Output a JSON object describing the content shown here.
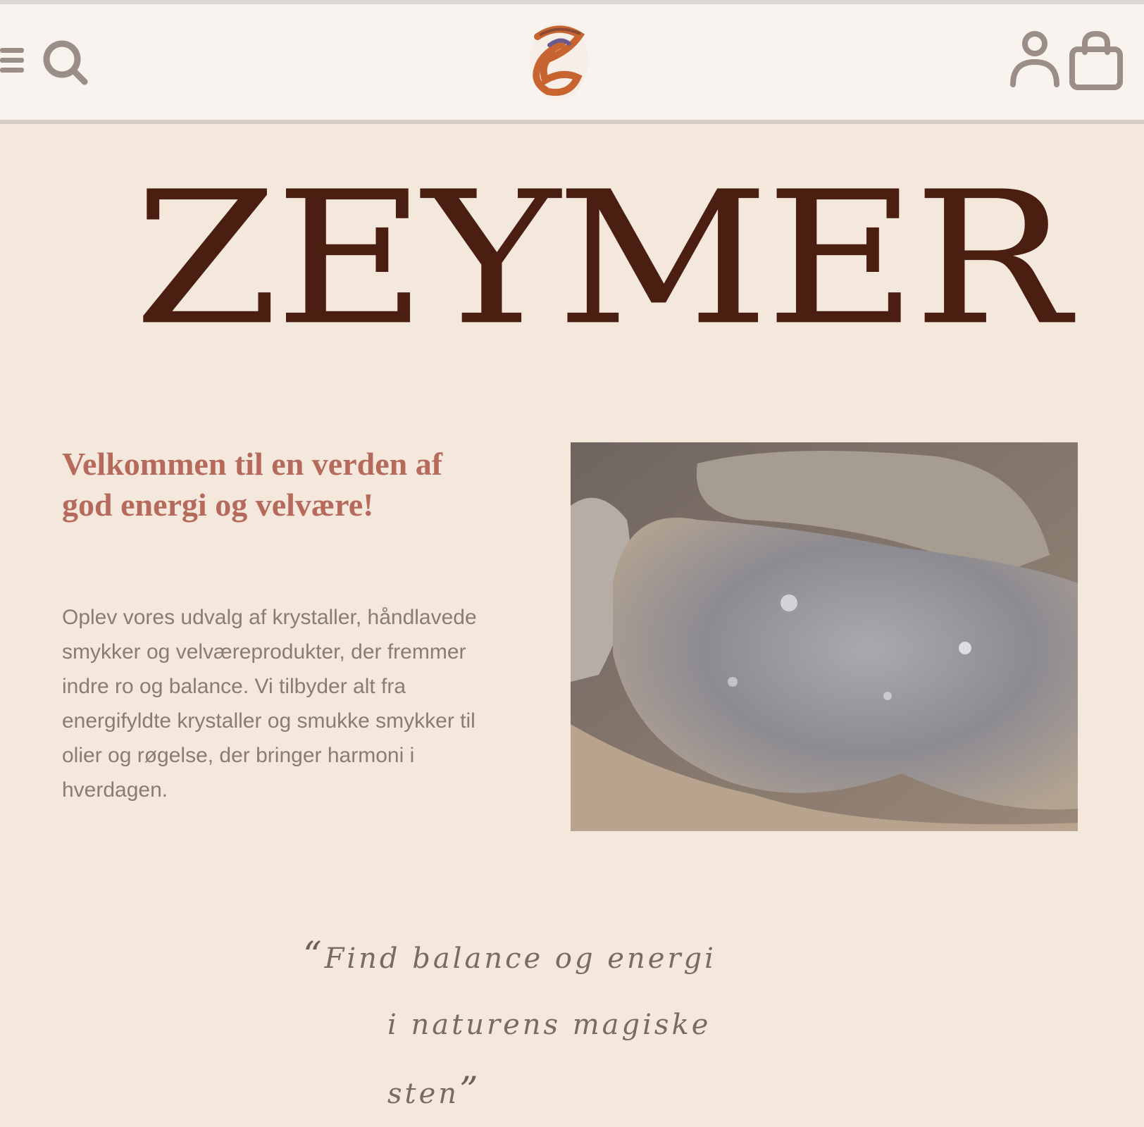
{
  "header": {
    "logo_name": "zeymer-logo",
    "icons": [
      "menu-icon",
      "search-icon",
      "account-icon",
      "cart-icon"
    ]
  },
  "hero": {
    "brand_title": "ZEYMER",
    "welcome_heading": "Velkommen til en verden af god energi og velvære!",
    "intro_text": "Oplev vores udvalg af krystaller, håndlavede smykker og velværeprodukter, der fremmer indre ro og balance. Vi tilbyder alt fra energifyldte krystaller og smukke smykker til olier og røgelse, der bringer harmoni i hverdagen.",
    "image_alt": "crystal-photo"
  },
  "quote": {
    "open_mark": "“",
    "line1": "Find balance og energi",
    "line2": "i naturens magiske sten",
    "close_mark": "”"
  },
  "colors": {
    "background": "#f4e8dd",
    "header_background": "#f8f3ee",
    "brand_text": "#4a1f12",
    "heading_accent": "#b56a5c",
    "body_text": "#8d7a72",
    "icon_color": "#9b8e87"
  }
}
